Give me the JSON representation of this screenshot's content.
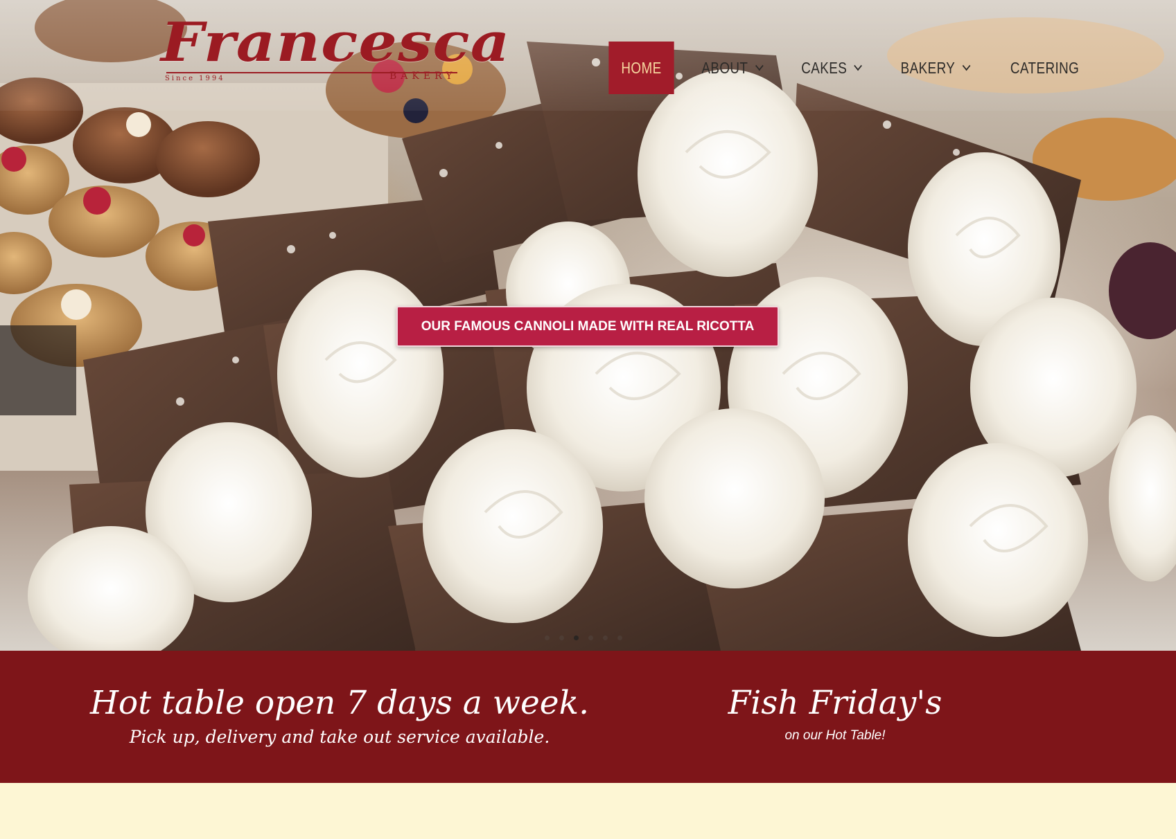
{
  "brand": {
    "name": "Francesca",
    "tagline": "BAKERY",
    "since": "Since 1994"
  },
  "nav": {
    "items": [
      {
        "label": "HOME",
        "active": true,
        "dropdown": false
      },
      {
        "label": "ABOUT",
        "active": false,
        "dropdown": true
      },
      {
        "label": "CAKES",
        "active": false,
        "dropdown": true
      },
      {
        "label": "BAKERY",
        "active": false,
        "dropdown": true
      },
      {
        "label": "CATERING",
        "active": false,
        "dropdown": false
      }
    ]
  },
  "hero": {
    "cta_label": "OUR FAMOUS CANNOLI MADE WITH REAL RICOTTA",
    "slider": {
      "count": 6,
      "active_index": 2
    }
  },
  "promo": {
    "left": {
      "headline": "Hot table open 7 days a week.",
      "sub": "Pick up, delivery and take out service available."
    },
    "right": {
      "headline": "Fish Friday's",
      "sub": "on our Hot Table!"
    }
  },
  "colors": {
    "brand_red": "#9b1b22",
    "nav_active": "#a11c2a",
    "cta_pink": "#b81f44",
    "band_red": "#7e1519",
    "cream": "#fdf6d4"
  }
}
